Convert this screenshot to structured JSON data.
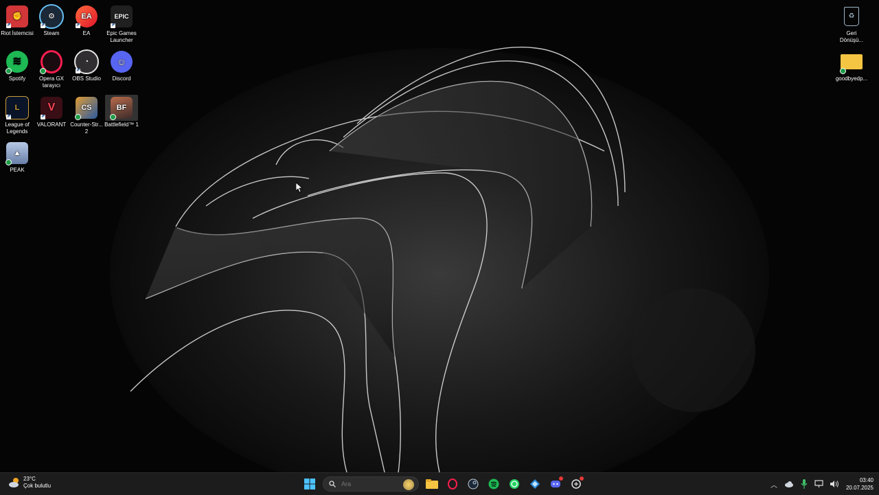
{
  "desktop": {
    "icons": [
      {
        "label": "Riot İstemcisi",
        "icon": "riot-icon",
        "color": "#d13639"
      },
      {
        "label": "Steam",
        "icon": "steam-icon",
        "color": "#1b2838"
      },
      {
        "label": "EA",
        "icon": "ea-icon",
        "color": "#ff4747"
      },
      {
        "label": "Epic Games Launcher",
        "icon": "epic-games-icon",
        "color": "#202020"
      },
      {
        "label": "Spotify",
        "icon": "spotify-icon",
        "color": "#1db954"
      },
      {
        "label": "Opera GX tarayıcı",
        "icon": "opera-gx-icon",
        "color": "#fa1e4e"
      },
      {
        "label": "OBS Studio",
        "icon": "obs-icon",
        "color": "#302e31"
      },
      {
        "label": "Discord",
        "icon": "discord-icon",
        "color": "#5865f2"
      },
      {
        "label": "League of Legends",
        "icon": "league-icon",
        "color": "#0a1428"
      },
      {
        "label": "VALORANT",
        "icon": "valorant-icon",
        "color": "#fd4556"
      },
      {
        "label": "Counter-Str... 2",
        "icon": "cs2-icon",
        "color": "#de9b35"
      },
      {
        "label": "Battlefield™ 1",
        "icon": "battlefield-icon",
        "color": "#7a4b3a"
      },
      {
        "label": "PEAK",
        "icon": "peak-icon",
        "color": "#8aa4c8"
      },
      {
        "label": "Geri Dönüşü...",
        "icon": "recycle-bin-icon",
        "color": "#9fb7c9"
      },
      {
        "label": "goodbyedp...",
        "icon": "folder-icon",
        "color": "#f4c542"
      }
    ]
  },
  "taskbar": {
    "weather": {
      "temp": "23°C",
      "desc": "Çok bulutlu"
    },
    "search_placeholder": "Ara",
    "apps": [
      "file-explorer-icon",
      "opera-gx-icon",
      "steam-icon",
      "spotify-icon",
      "whatsapp-icon",
      "app-icon",
      "discord-icon",
      "chatgpt-icon"
    ],
    "clock": {
      "time": "03:40",
      "date": "20.07.2025"
    }
  }
}
